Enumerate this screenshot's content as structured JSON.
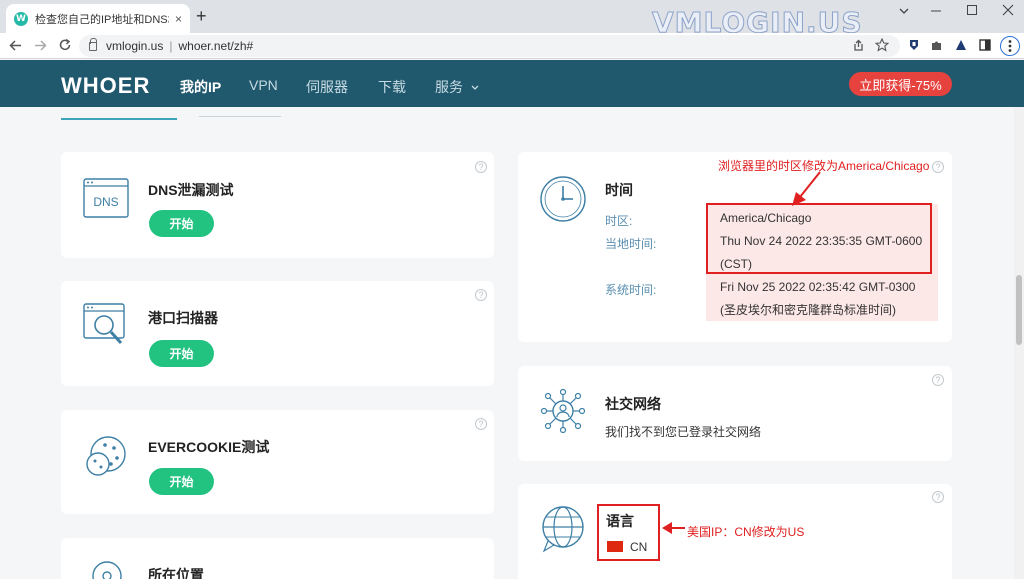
{
  "browser": {
    "tab_title": "检查您自己的IP地址和DNS地址",
    "tab_favicon": "W",
    "tab_close": "×",
    "new_tab": "+",
    "url_host": "vmlogin.us",
    "url_path": "whoer.net/zh#",
    "watermark": "VMLOGIN.US",
    "icons": [
      "back-icon",
      "forward-icon",
      "reload-icon",
      "lock-icon",
      "share-icon",
      "star-icon",
      "extension-icon",
      "puzzle-icon",
      "profile-icon",
      "sidebar-icon",
      "menu-icon"
    ]
  },
  "header": {
    "logo": "WHOER",
    "nav": [
      {
        "label": "我的IP",
        "active": true
      },
      {
        "label": "VPN"
      },
      {
        "label": "伺服器"
      },
      {
        "label": "下载"
      },
      {
        "label": "服务"
      }
    ],
    "promo": "立即获得-75%"
  },
  "left_cards": [
    {
      "title": "DNS泄漏测试",
      "button": "开始",
      "icon": "dns-icon",
      "icon_text": "DNS"
    },
    {
      "title": "港口扫描器",
      "button": "开始",
      "icon": "port-scanner-icon"
    },
    {
      "title": "EVERCOOKIE测试",
      "button": "开始",
      "icon": "cookie-icon"
    },
    {
      "title": "所在位置",
      "icon": "location-icon"
    }
  ],
  "time_card": {
    "title": "时间",
    "timezone_label": "时区:",
    "timezone_value": "America/Chicago",
    "local_label": "当地时间:",
    "local_value_1": "Thu Nov 24 2022 23:35:35 GMT-0600",
    "local_value_2": "(CST)",
    "system_label": "系统时间:",
    "system_value_1": "Fri Nov 25 2022 02:35:42 GMT-0300",
    "system_value_2": "(圣皮埃尔和密克隆群岛标准时间)",
    "annotation": "浏览器里的时区修改为America/Chicago"
  },
  "social_card": {
    "title": "社交网络",
    "text": "我们找不到您已登录社交网络"
  },
  "language_card": {
    "title": "语言",
    "code": "CN",
    "annotation": "美国IP：CN修改为US"
  },
  "colors": {
    "header_bg": "#20586e",
    "accent_green": "#22c281",
    "promo_red": "#e6423e",
    "annotation_red": "#e02020"
  }
}
